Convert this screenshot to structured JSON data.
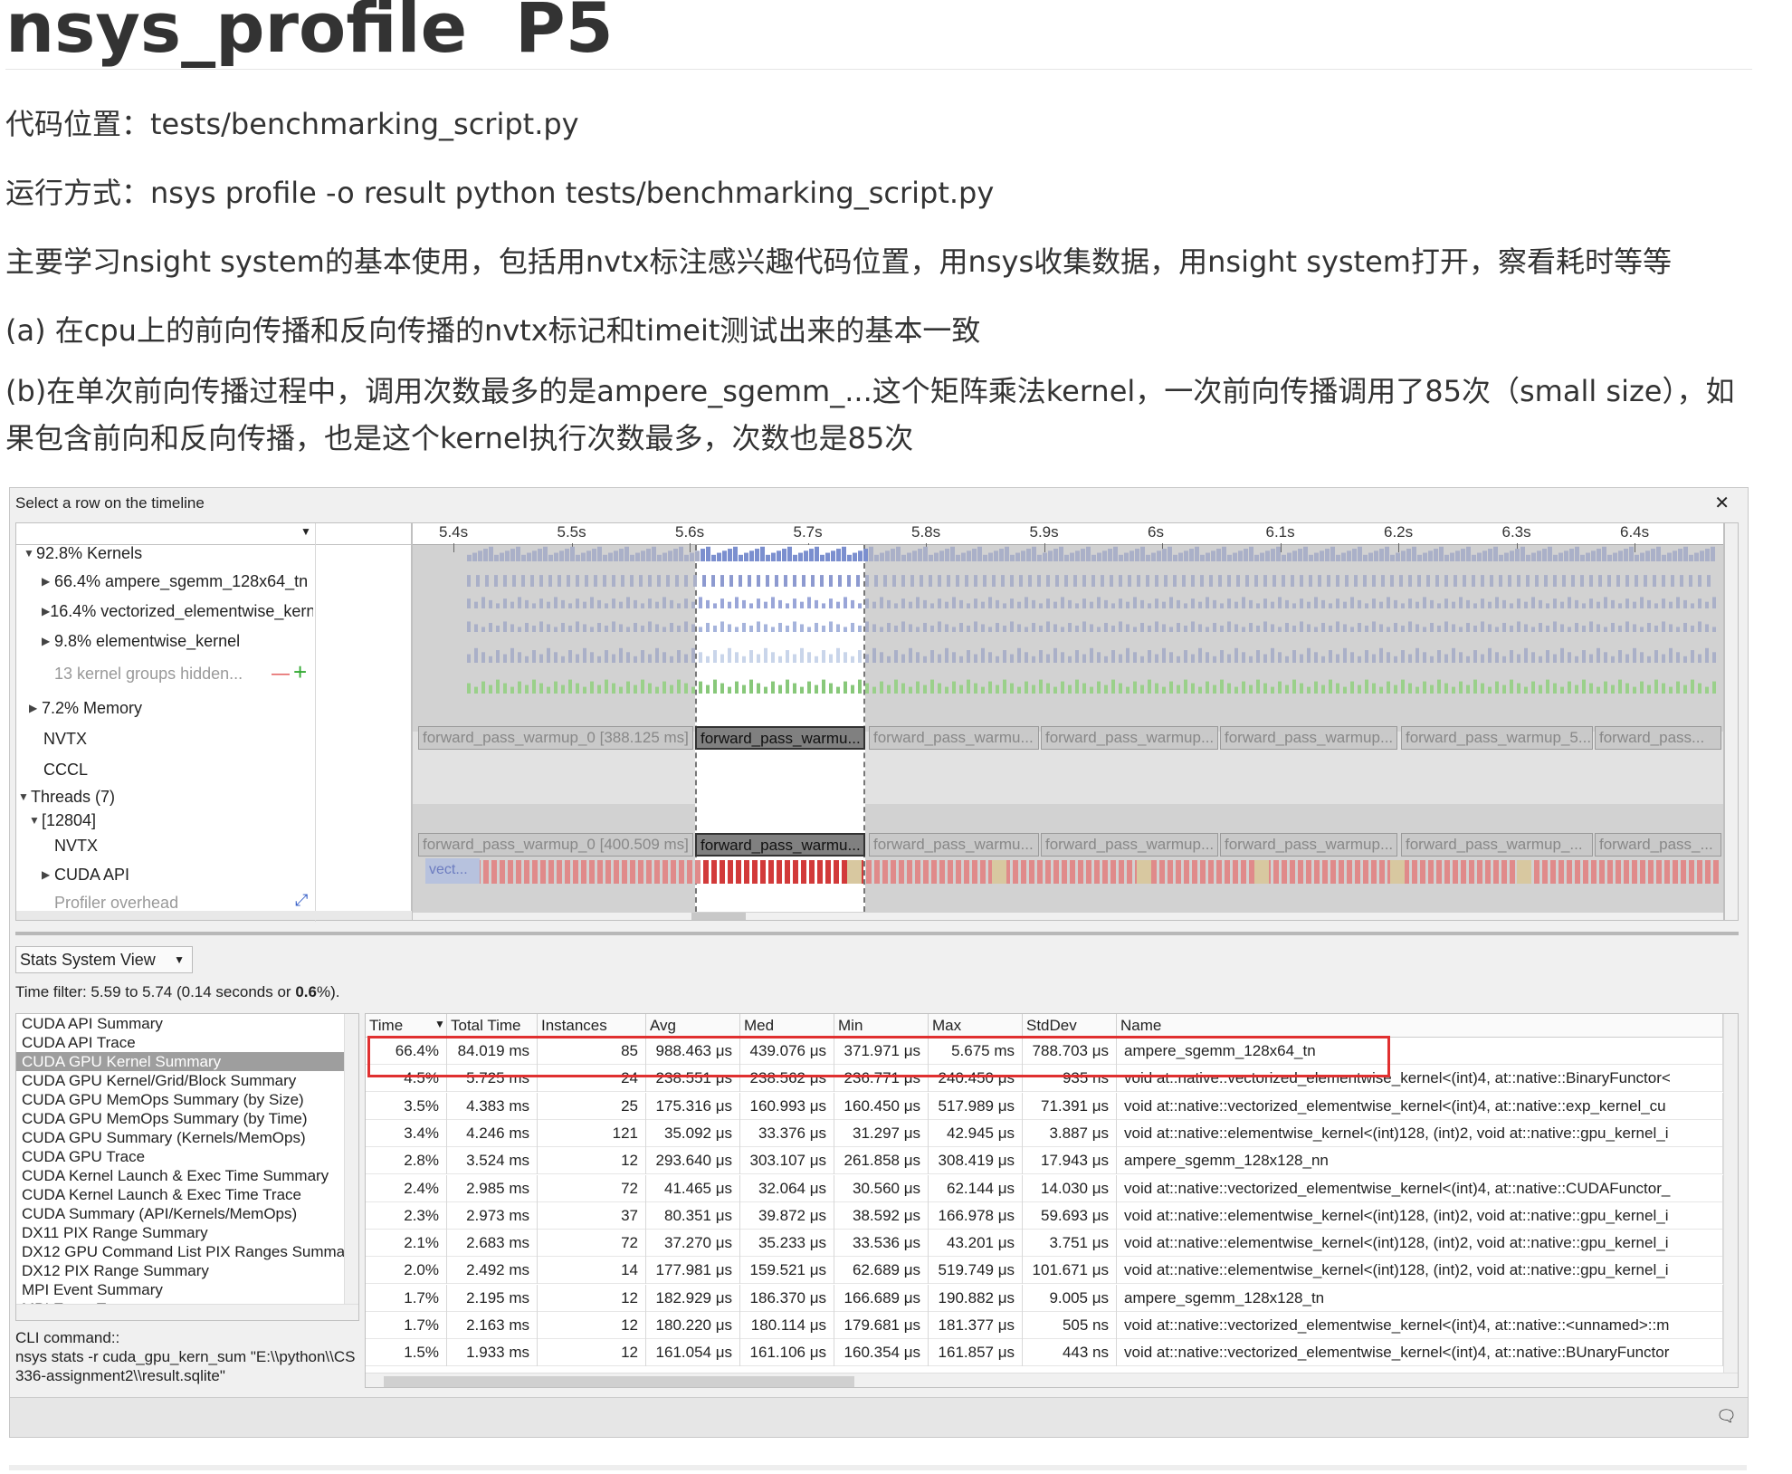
{
  "page": {
    "title": "nsys_profile  P5",
    "lines": [
      "代码位置：tests/benchmarking_script.py",
      "运行方式：nsys profile -o result python tests/benchmarking_script.py",
      "主要学习nsight system的基本使用，包括用nvtx标注感兴趣代码位置，用nsys收集数据，用nsight system打开，察看耗时等等",
      "(a) 在cpu上的前向传播和反向传播的nvtx标记和timeit测试出来的基本一致",
      "(b)在单次前向传播过程中，调用次数最多的是ampere_sgemm_...这个矩阵乘法kernel，一次前向传播调用了85次（small size），如果包含前向和反向传播，也是这个kernel执行次数最多，次数也是85次"
    ]
  },
  "app": {
    "header_text": "Select a row on the timeline",
    "close_glyph": "✕",
    "timeline": {
      "ticks": [
        "5.4s",
        "5.5s",
        "5.6s",
        "5.7s",
        "5.8s",
        "5.9s",
        "6s",
        "6.1s",
        "6.2s",
        "6.3s",
        "6.4s"
      ],
      "rows": {
        "kernels": "92.8% Kernels",
        "k1": "66.4% ampere_sgemm_128x64_tn",
        "k2": "16.4% vectorized_elementwise_kerne",
        "k3": "9.8% elementwise_kernel",
        "hidden": "13 kernel groups hidden...",
        "minus": "—",
        "plus": "+",
        "memory": "7.2% Memory",
        "nvtx": "NVTX",
        "cccl": "CCCL",
        "threads": "Threads (7)",
        "thread_id": "[12804]",
        "thread_nvtx": "NVTX",
        "cuda_api": "CUDA API",
        "profiler": "Profiler overhead"
      },
      "nvtx_bars": [
        "forward_pass_warmup_0 [388.125 ms]",
        "forward_pass_warmu...",
        "forward_pass_warmu...",
        "forward_pass_warmup...",
        "forward_pass_warmup...",
        "forward_pass_warmup_5...",
        "forward_pass..."
      ],
      "thread_nvtx_bars": [
        "forward_pass_warmup_0 [400.509 ms]",
        "forward_pass_warmu...",
        "forward_pass_warmu...",
        "forward_pass_warmup...",
        "forward_pass_warmup...",
        "forward_pass_warmup_...",
        "forward_pass_..."
      ],
      "cuda_api_label": "vect..."
    },
    "stats": {
      "view_select": "Stats System View",
      "time_filter_prefix": "Time filter: 5.59 to 5.74 (0.14 seconds or ",
      "time_filter_bold": "0.6",
      "time_filter_suffix": "%).",
      "reports": [
        "CUDA API Summary",
        "CUDA API Trace",
        "CUDA GPU Kernel Summary",
        "CUDA GPU Kernel/Grid/Block Summary",
        "CUDA GPU MemOps Summary (by Size)",
        "CUDA GPU MemOps Summary (by Time)",
        "CUDA GPU Summary (Kernels/MemOps)",
        "CUDA GPU Trace",
        "CUDA Kernel Launch & Exec Time Summary",
        "CUDA Kernel Launch & Exec Time Trace",
        "CUDA Summary (API/Kernels/MemOps)",
        "DX11 PIX Range Summary",
        "DX12 GPU Command List PIX Ranges Summa",
        "DX12 PIX Range Summary",
        "MPI Event Summary",
        "MPI Event Trace"
      ],
      "selected_report": 2,
      "cli_label": "CLI command::",
      "cli_cmd": "nsys stats -r cuda_gpu_kern_sum \"E:\\\\python\\\\CS336-assignment2\\\\result.sqlite\"",
      "columns": [
        "Time",
        "Total Time",
        "Instances",
        "Avg",
        "Med",
        "Min",
        "Max",
        "StdDev",
        "Name"
      ],
      "rows": [
        [
          "66.4%",
          "84.019 ms",
          "85",
          "988.463 μs",
          "439.076 μs",
          "371.971 μs",
          "5.675 ms",
          "788.703 μs",
          "ampere_sgemm_128x64_tn"
        ],
        [
          "4.5%",
          "5.725 ms",
          "24",
          "238.551 μs",
          "238.562 μs",
          "236.771 μs",
          "240.450 μs",
          "935 ns",
          "void at::native::vectorized_elementwise_kernel<(int)4, at::native::BinaryFunctor<"
        ],
        [
          "3.5%",
          "4.383 ms",
          "25",
          "175.316 μs",
          "160.993 μs",
          "160.450 μs",
          "517.989 μs",
          "71.391 μs",
          "void at::native::vectorized_elementwise_kernel<(int)4, at::native::exp_kernel_cu"
        ],
        [
          "3.4%",
          "4.246 ms",
          "121",
          "35.092 μs",
          "33.376 μs",
          "31.297 μs",
          "42.945 μs",
          "3.887 μs",
          "void at::native::elementwise_kernel<(int)128, (int)2, void at::native::gpu_kernel_i"
        ],
        [
          "2.8%",
          "3.524 ms",
          "12",
          "293.640 μs",
          "303.107 μs",
          "261.858 μs",
          "308.419 μs",
          "17.943 μs",
          "ampere_sgemm_128x128_nn"
        ],
        [
          "2.4%",
          "2.985 ms",
          "72",
          "41.465 μs",
          "32.064 μs",
          "30.560 μs",
          "62.144 μs",
          "14.030 μs",
          "void at::native::vectorized_elementwise_kernel<(int)4, at::native::CUDAFunctor_"
        ],
        [
          "2.3%",
          "2.973 ms",
          "37",
          "80.351 μs",
          "39.872 μs",
          "38.592 μs",
          "166.978 μs",
          "59.693 μs",
          "void at::native::elementwise_kernel<(int)128, (int)2, void at::native::gpu_kernel_i"
        ],
        [
          "2.1%",
          "2.683 ms",
          "72",
          "37.270 μs",
          "35.233 μs",
          "33.536 μs",
          "43.201 μs",
          "3.751 μs",
          "void at::native::elementwise_kernel<(int)128, (int)2, void at::native::gpu_kernel_i"
        ],
        [
          "2.0%",
          "2.492 ms",
          "14",
          "177.981 μs",
          "159.521 μs",
          "62.689 μs",
          "519.749 μs",
          "101.671 μs",
          "void at::native::elementwise_kernel<(int)128, (int)2, void at::native::gpu_kernel_i"
        ],
        [
          "1.7%",
          "2.195 ms",
          "12",
          "182.929 μs",
          "186.370 μs",
          "166.689 μs",
          "190.882 μs",
          "9.005 μs",
          "ampere_sgemm_128x128_tn"
        ],
        [
          "1.7%",
          "2.163 ms",
          "12",
          "180.220 μs",
          "180.114 μs",
          "179.681 μs",
          "181.377 μs",
          "505 ns",
          "void at::native::vectorized_elementwise_kernel<(int)4, at::native::<unnamed>::m"
        ],
        [
          "1.5%",
          "1.933 ms",
          "12",
          "161.054 μs",
          "161.106 μs",
          "160.354 μs",
          "161.857 μs",
          "443 ns",
          "void at::native::vectorized_elementwise_kernel<(int)4, at::native::BUnaryFunctor"
        ]
      ],
      "highlight_color": "#e03030"
    }
  }
}
